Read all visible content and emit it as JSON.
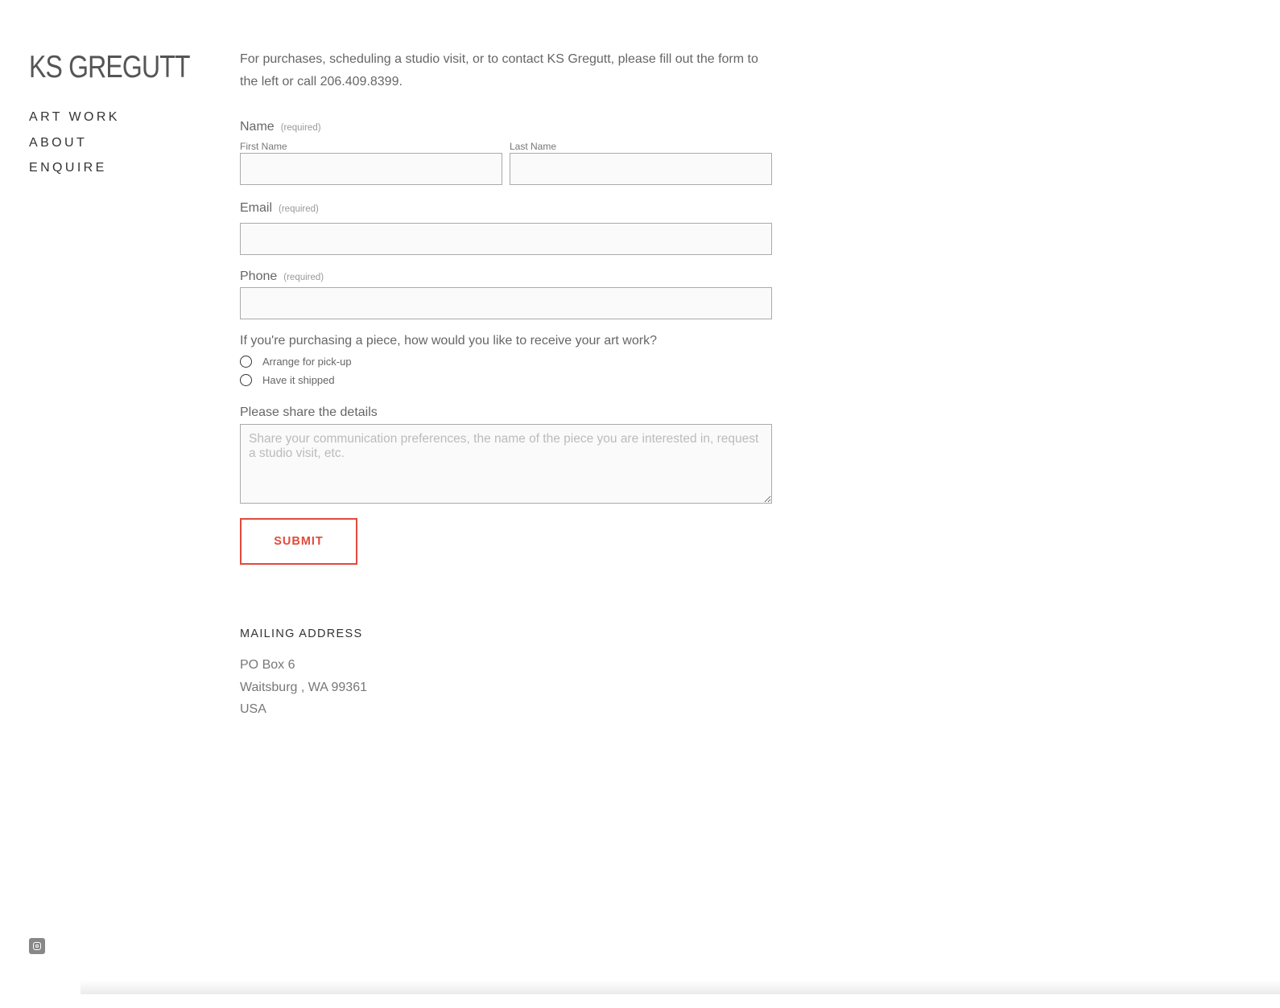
{
  "site": {
    "title": "KS GREGUTT"
  },
  "nav": {
    "items": [
      {
        "label": "ART WORK"
      },
      {
        "label": "ABOUT"
      },
      {
        "label": "ENQUIRE"
      }
    ]
  },
  "intro": "For purchases, scheduling a studio visit, or to contact KS Gregutt, please fill out the form to the left or call 206.409.8399.",
  "form": {
    "name": {
      "label": "Name",
      "required": "(required)",
      "first_label": "First Name",
      "last_label": "Last Name",
      "first_value": "",
      "last_value": ""
    },
    "email": {
      "label": "Email",
      "required": "(required)",
      "value": ""
    },
    "phone": {
      "label": "Phone",
      "required": "(required)",
      "value": ""
    },
    "delivery": {
      "question": "If you're purchasing a piece, how would you like to receive your art work?",
      "options": [
        {
          "label": "Arrange for pick-up",
          "selected": false
        },
        {
          "label": "Have it shipped",
          "selected": false
        }
      ]
    },
    "details": {
      "label": "Please share the details",
      "placeholder": "Share your communication preferences, the name of the piece you are interested in, request a studio visit, etc.",
      "value": ""
    },
    "submit_label": "SUBMIT"
  },
  "mailing": {
    "heading": "MAILING ADDRESS",
    "lines": [
      "PO Box 6",
      "Waitsburg , WA 99361",
      "USA"
    ]
  },
  "social": {
    "icon": "instagram-icon"
  },
  "colors": {
    "accent": "#e24a3b",
    "input_bg": "#fafafa",
    "input_border": "#aaaaaa"
  }
}
